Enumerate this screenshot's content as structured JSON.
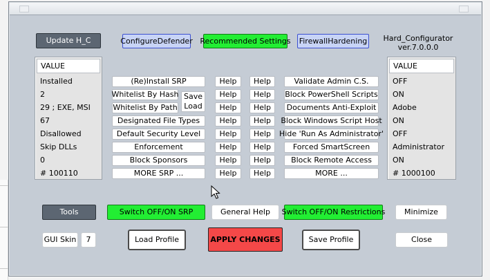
{
  "app": {
    "name": "Hard_Configurator",
    "version": "ver.7.0.0.0"
  },
  "top_buttons": {
    "update": "Update H_C",
    "configure_defender": "ConfigureDefender",
    "recommended_settings": "Recommended Settings",
    "firewall_hardening": "FirewallHardening"
  },
  "left_panel": {
    "header": "VALUE",
    "rows": [
      "Installed",
      "2",
      "29 ;  EXE, MSI",
      "67",
      "Disallowed",
      "Skip DLLs",
      "0",
      "# 100110"
    ]
  },
  "right_panel": {
    "header": "VALUE",
    "rows": [
      "OFF",
      "ON",
      "Adobe",
      "ON",
      "OFF",
      "Administrator",
      "ON",
      "# 1000100"
    ]
  },
  "srp_options": {
    "reinstall_srp": "(Re)Install SRP",
    "whitelist_by_hash": "Whitelist By Hash",
    "whitelist_by_path": "Whitelist By Path",
    "save": "Save",
    "load": "Load",
    "designated_file_types": "Designated File Types",
    "default_security_level": "Default Security Level",
    "enforcement": "Enforcement",
    "block_sponsors": "Block Sponsors",
    "more_srp": "MORE SRP ..."
  },
  "help_label": "Help",
  "restriction_options": {
    "validate_admin": "Validate Admin C.S.",
    "block_powershell": "Block PowerShell Scripts",
    "documents_anti_exploit": "Documents Anti-Exploit",
    "block_wsh": "Block Windows Script Host",
    "hide_run_as_admin": "Hide  'Run As Administrator'",
    "forced_smartscreen": "Forced SmartScreen",
    "block_remote_access": "Block Remote Access",
    "more": "MORE ..."
  },
  "bottom": {
    "tools": "Tools",
    "switch_srp": "Switch OFF/ON SRP",
    "general_help": "General Help",
    "switch_restrictions": "Switch OFF/ON Restrictions",
    "minimize": "Minimize",
    "gui_skin_label": "GUI Skin",
    "gui_skin_value": "7",
    "load_profile": "Load Profile",
    "apply_changes": "APPLY CHANGES",
    "save_profile": "Save Profile",
    "close": "Close"
  },
  "colors": {
    "window_bg": "#c5ccd5",
    "green": "#22ee33",
    "blue": "#c8d4f6",
    "red": "#f44848",
    "dark": "#5c6672"
  }
}
